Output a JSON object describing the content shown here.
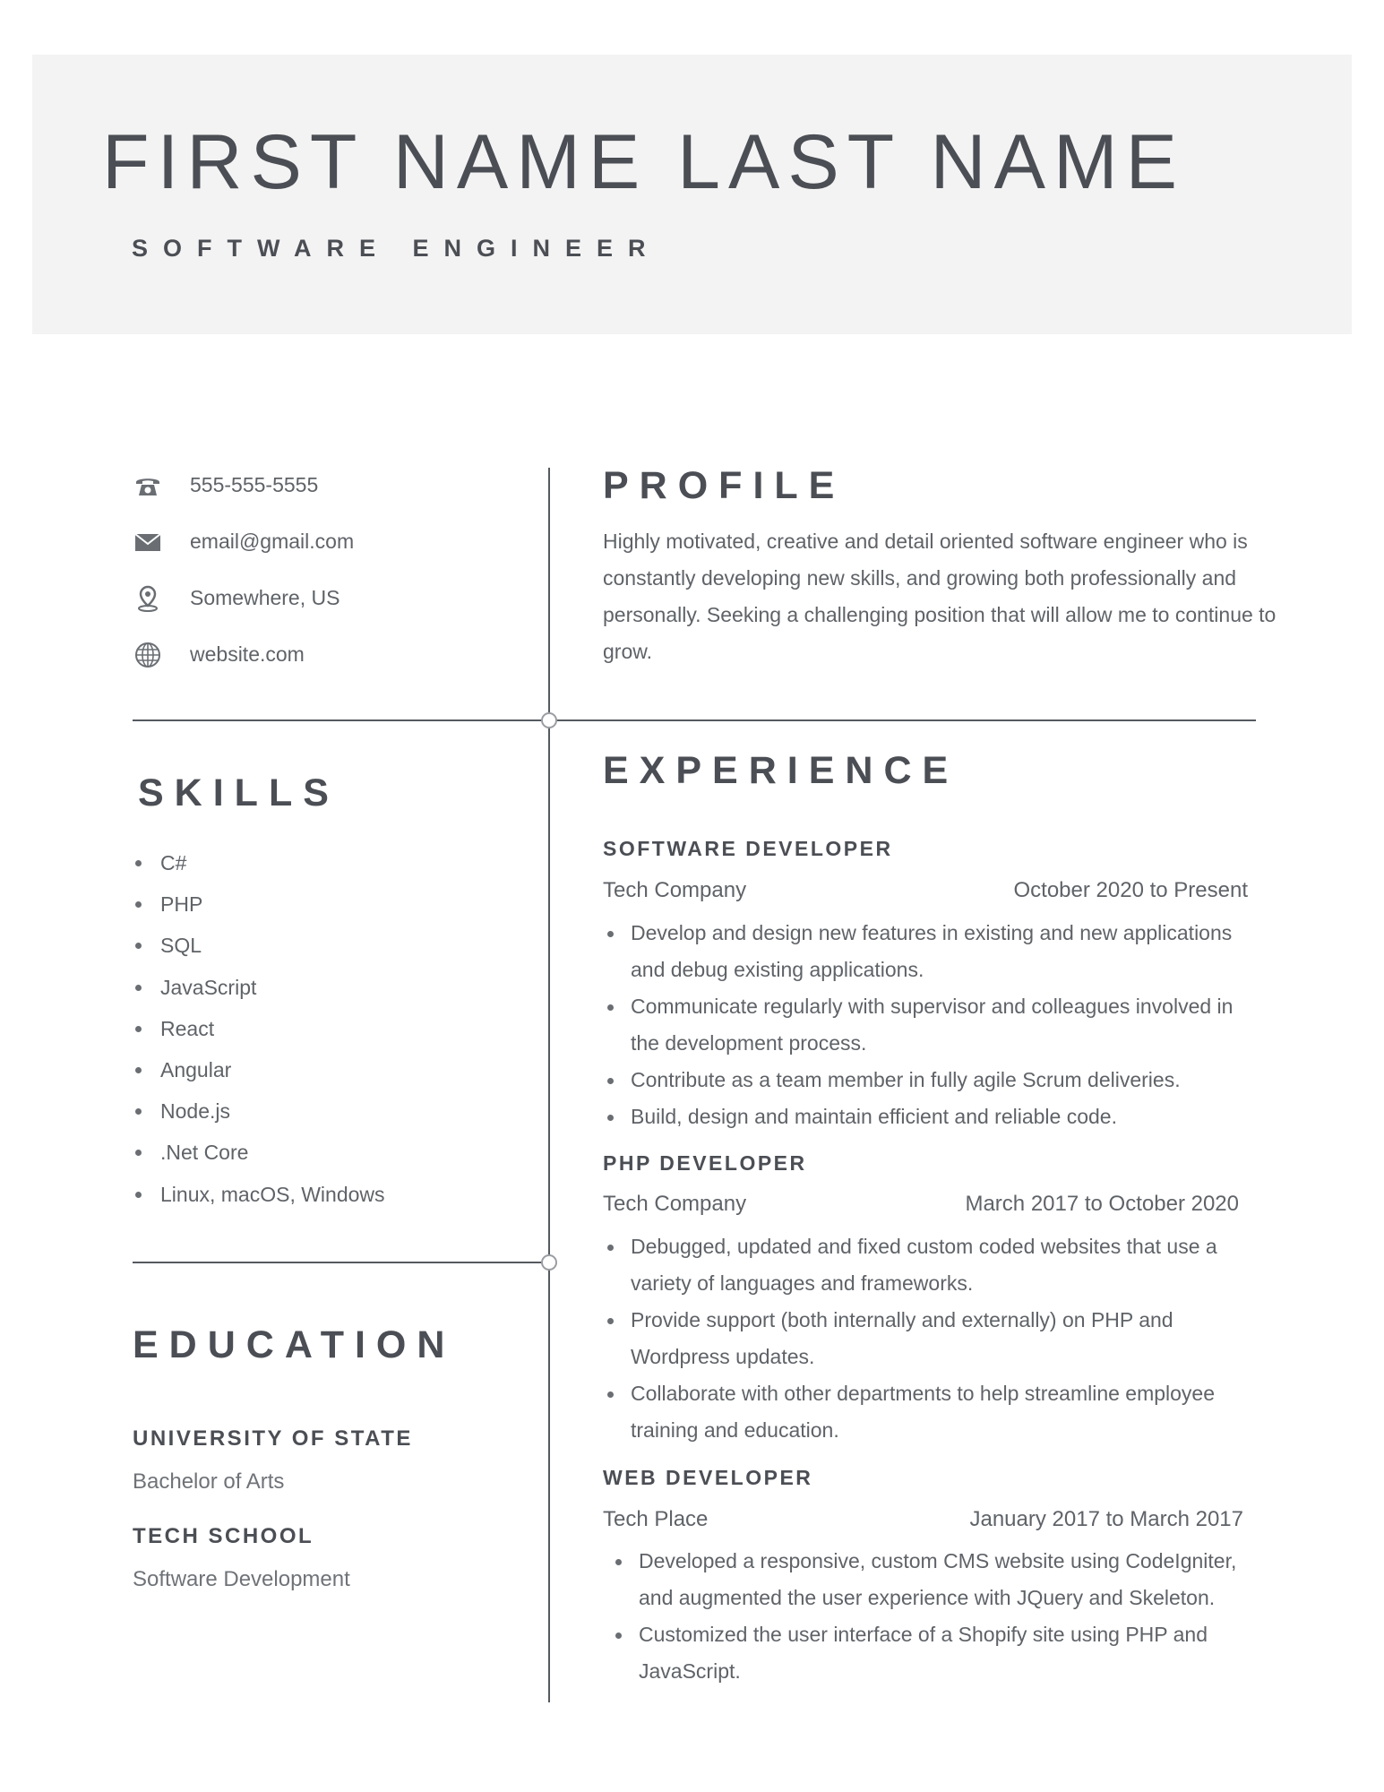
{
  "header": {
    "name": "FIRST NAME LAST NAME",
    "title": "SOFTWARE ENGINEER"
  },
  "contact": {
    "phone": "555-555-5555",
    "email": "email@gmail.com",
    "location": "Somewhere, US",
    "website": "website.com"
  },
  "profile": {
    "heading": "PROFILE",
    "text": "Highly motivated, creative and detail oriented software engineer who is constantly developing new skills, and growing both professionally and personally. Seeking a challenging position that will allow me to continue to grow."
  },
  "skills": {
    "heading": "SKILLS",
    "items": [
      "C#",
      "PHP",
      "SQL",
      "JavaScript",
      "React",
      "Angular",
      "Node.js",
      ".Net Core",
      "Linux, macOS, Windows"
    ]
  },
  "education": {
    "heading": "EDUCATION",
    "entries": [
      {
        "school": "UNIVERSITY OF STATE",
        "degree": "Bachelor of Arts"
      },
      {
        "school": "TECH SCHOOL",
        "degree": "Software Development"
      }
    ]
  },
  "experience": {
    "heading": "EXPERIENCE",
    "jobs": [
      {
        "title": "SOFTWARE DEVELOPER",
        "company": "Tech Company",
        "dates": "October 2020 to Present",
        "bullets": [
          "Develop  and design new features in existing and new applications and debug existing applications.",
          "Communicate regularly with supervisor and colleagues involved in the development process.",
          "Contribute as a team member in fully agile Scrum deliveries.",
          "Build, design and maintain efficient and reliable code."
        ]
      },
      {
        "title": "PHP DEVELOPER",
        "company": "Tech Company",
        "dates": "March 2017 to October 2020",
        "bullets": [
          "Debugged, updated and fixed custom coded websites that use a variety of languages and frameworks.",
          "Provide support (both internally and externally) on PHP and Wordpress updates.",
          "Collaborate with other departments to help streamline employee training and education."
        ]
      },
      {
        "title": "WEB DEVELOPER",
        "company": "Tech Place",
        "dates": "January 2017 to March 2017",
        "bullets": [
          "Developed a responsive, custom CMS website using CodeIgniter, and augmented the user experience with JQuery and Skeleton.",
          "Customized the user interface of a Shopify site using PHP and JavaScript."
        ]
      }
    ]
  },
  "icons": {
    "phone": "phone-icon",
    "email": "envelope-icon",
    "location": "map-pin-icon",
    "website": "globe-icon"
  },
  "colors": {
    "header_band": "#f3f3f3",
    "heading_text": "#4b4e54",
    "body_text": "#5f6368",
    "divider": "#555a60"
  }
}
